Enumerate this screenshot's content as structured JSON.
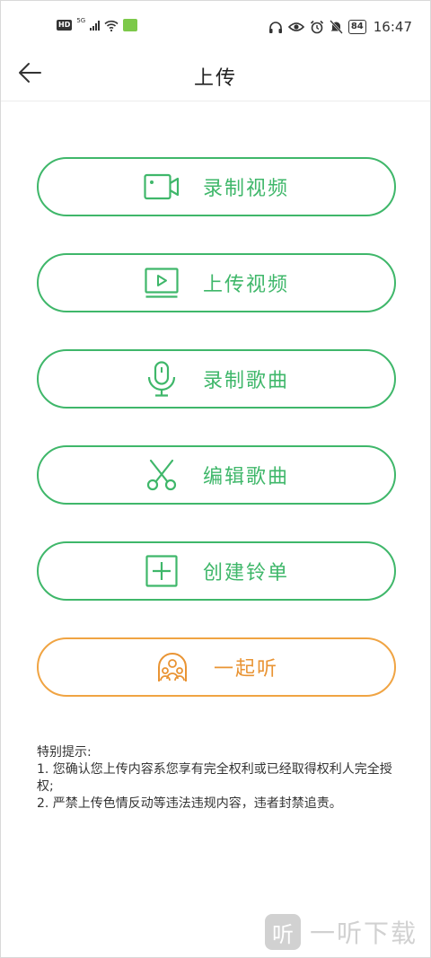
{
  "status_bar": {
    "hd": "HD",
    "network": "5G",
    "battery": "84",
    "time": "16:47",
    "colors": {
      "icon": "#333333",
      "app_badge": "#7dc94a"
    }
  },
  "header": {
    "title": "上传",
    "back_icon": "arrow-left-icon"
  },
  "actions": [
    {
      "label": "录制视频",
      "icon": "video-camera-icon",
      "color": "#3fb76a"
    },
    {
      "label": "上传视频",
      "icon": "video-play-icon",
      "color": "#3fb76a"
    },
    {
      "label": "录制歌曲",
      "icon": "microphone-icon",
      "color": "#3fb76a"
    },
    {
      "label": "编辑歌曲",
      "icon": "scissors-icon",
      "color": "#3fb76a"
    },
    {
      "label": "创建铃单",
      "icon": "plus-square-icon",
      "color": "#3fb76a"
    },
    {
      "label": "一起听",
      "icon": "listen-together-icon",
      "color": "#e99434"
    }
  ],
  "notice": {
    "title": "特别提示:",
    "line1": "1. 您确认您上传内容系您享有完全权利或已经取得权利人完全授权;",
    "line2": "2. 严禁上传色情反动等违法违规内容，违者封禁追责。"
  },
  "watermark": {
    "logo_char": "听",
    "text": "一听下载"
  }
}
